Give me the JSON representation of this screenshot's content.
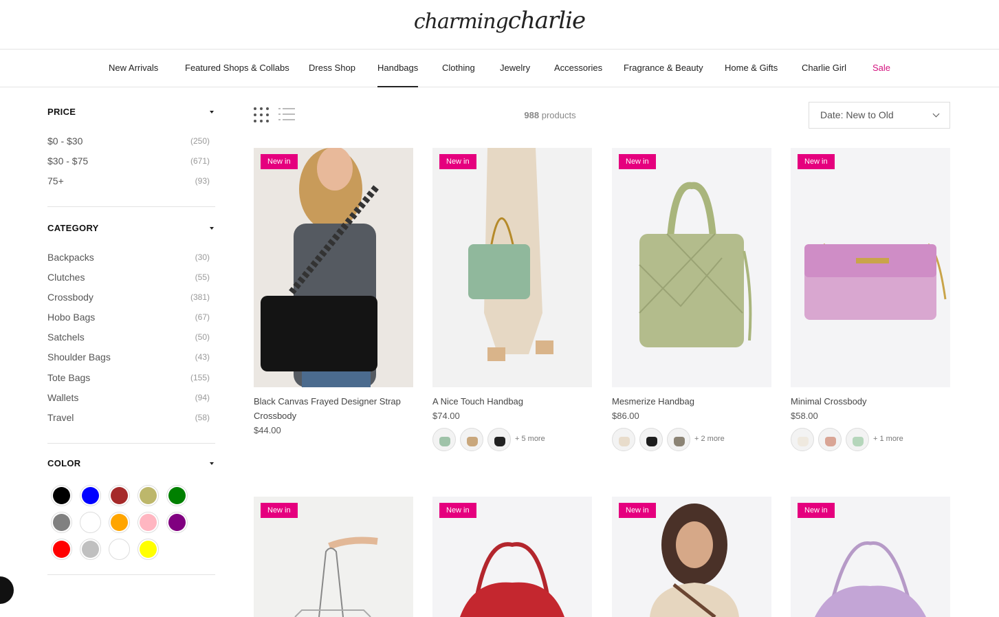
{
  "brand": {
    "logo_a": "charming",
    "logo_b": "charlie"
  },
  "nav": [
    {
      "label": "New Arrivals"
    },
    {
      "label": "Featured Shops & Collabs"
    },
    {
      "label": "Dress Shop"
    },
    {
      "label": "Handbags",
      "active": true
    },
    {
      "label": "Clothing"
    },
    {
      "label": "Jewelry"
    },
    {
      "label": "Accessories"
    },
    {
      "label": "Fragrance & Beauty"
    },
    {
      "label": "Home & Gifts"
    },
    {
      "label": "Charlie Girl"
    },
    {
      "label": "Sale"
    }
  ],
  "filters": {
    "price": {
      "title": "PRICE",
      "items": [
        {
          "label": "$0 - $30",
          "count": "(250)"
        },
        {
          "label": "$30 - $75",
          "count": "(671)"
        },
        {
          "label": "75+",
          "count": "(93)"
        }
      ]
    },
    "category": {
      "title": "CATEGORY",
      "items": [
        {
          "label": "Backpacks",
          "count": "(30)"
        },
        {
          "label": "Clutches",
          "count": "(55)"
        },
        {
          "label": "Crossbody",
          "count": "(381)"
        },
        {
          "label": "Hobo Bags",
          "count": "(67)"
        },
        {
          "label": "Satchels",
          "count": "(50)"
        },
        {
          "label": "Shoulder Bags",
          "count": "(43)"
        },
        {
          "label": "Tote Bags",
          "count": "(155)"
        },
        {
          "label": "Wallets",
          "count": "(94)"
        },
        {
          "label": "Travel",
          "count": "(58)"
        }
      ]
    },
    "color": {
      "title": "COLOR",
      "swatches": [
        "#000000",
        "#0000ff",
        "#a52a2a",
        "#bdb76b",
        "#008000",
        "#808080",
        "#ffffff",
        "#ffa500",
        "#ffb6c1",
        "#800080",
        "#ff0000",
        "#c0c0c0",
        "#ffffff",
        "#ffff00"
      ]
    }
  },
  "toolbar": {
    "count_number": "988",
    "count_label": "products",
    "sort_label": "Date: New to Old"
  },
  "products": [
    {
      "badge": "New in",
      "title": "Black Canvas Frayed Designer Strap Crossbody",
      "price": "$44.00",
      "thumbs": [],
      "more": ""
    },
    {
      "badge": "New in",
      "title": "A Nice Touch Handbag",
      "price": "$74.00",
      "thumbs": [
        "#9fc3a9",
        "#c9a77c",
        "#222222"
      ],
      "more": "+ 5 more"
    },
    {
      "badge": "New in",
      "title": "Mesmerize Handbag",
      "price": "$86.00",
      "thumbs": [
        "#e8dccb",
        "#1e1e1e",
        "#8c8475"
      ],
      "more": "+ 2 more"
    },
    {
      "badge": "New in",
      "title": "Minimal Crossbody",
      "price": "$58.00",
      "thumbs": [
        "#efe9df",
        "#d9a595",
        "#b5d6bb"
      ],
      "more": "+ 1 more"
    },
    {
      "badge": "New in",
      "title": "",
      "price": "",
      "thumbs": [],
      "more": ""
    },
    {
      "badge": "New in",
      "title": "",
      "price": "",
      "thumbs": [],
      "more": ""
    },
    {
      "badge": "New in",
      "title": "",
      "price": "",
      "thumbs": [],
      "more": ""
    },
    {
      "badge": "New in",
      "title": "",
      "price": "",
      "thumbs": [],
      "more": ""
    }
  ]
}
